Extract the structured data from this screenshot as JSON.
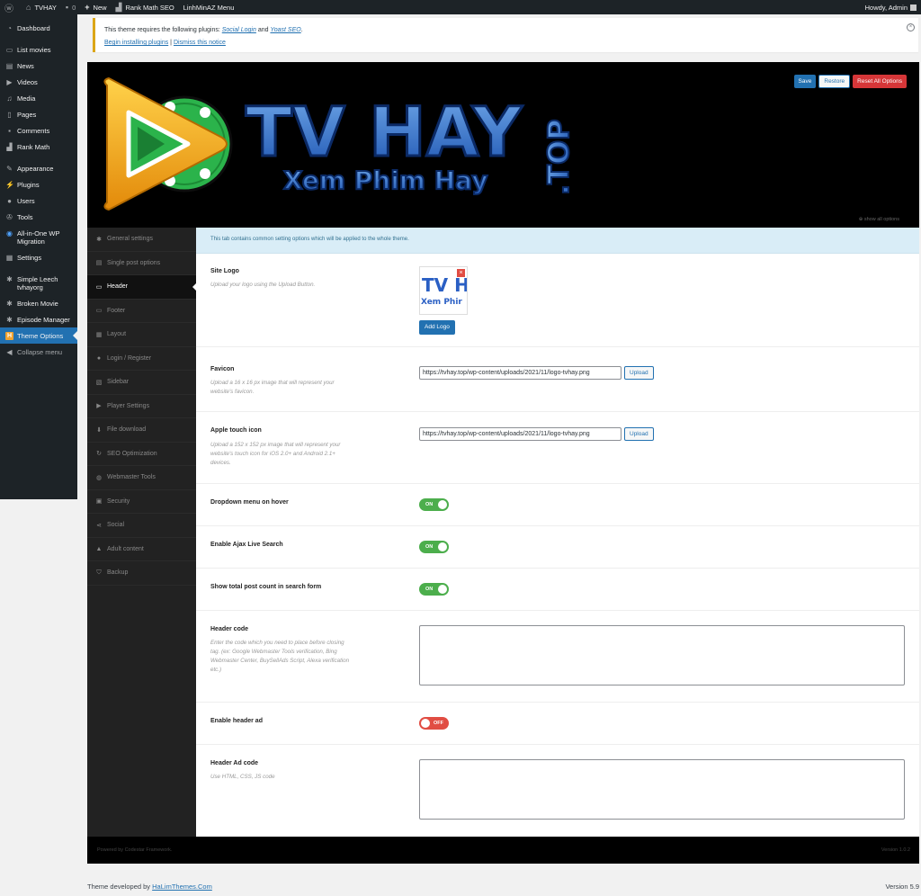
{
  "adminbar": {
    "site": "TVHAY",
    "comments": "0",
    "new": "New",
    "rankmath": "Rank Math SEO",
    "custom_menu": "LinhMinAZ Menu",
    "howdy": "Howdy, Admin"
  },
  "menu": {
    "dashboard": "Dashboard",
    "list_movies": "List movies",
    "news": "News",
    "videos": "Videos",
    "media": "Media",
    "pages": "Pages",
    "comments": "Comments",
    "rank_math": "Rank Math",
    "appearance": "Appearance",
    "plugins": "Plugins",
    "users": "Users",
    "tools": "Tools",
    "all_in_one": "All-in-One WP Migration",
    "settings": "Settings",
    "simple_leech": "Simple Leech tvhayorg",
    "broken_movie": "Broken Movie",
    "episode_manager": "Episode Manager",
    "theme_options": "Theme Options",
    "theme_options_badge": "H",
    "collapse": "Collapse menu"
  },
  "notice": {
    "prefix": "This theme requires the following plugins: ",
    "plugin1": "Social Login",
    "and": " and ",
    "plugin2": "Yoast SEO",
    "suffix": ".",
    "begin": "Begin installing plugins",
    "sep": " | ",
    "dismiss": "Dismiss this notice"
  },
  "banner": {
    "title": "TV HAY",
    "subtitle": "Xem Phim Hay",
    "tld": ".TOP",
    "save": "Save",
    "restore": "Restore",
    "reset": "Reset All Options",
    "show_all": "⊕ show all options"
  },
  "tabs": {
    "general": "General settings",
    "single_post": "Single post options",
    "header": "Header",
    "footer": "Footer",
    "layout": "Layout",
    "login": "Login / Register",
    "sidebar": "Sidebar",
    "player": "Player Settings",
    "file_download": "File download",
    "seo": "SEO Optimization",
    "webmaster": "Webmaster Tools",
    "security": "Security",
    "social": "Social",
    "adult": "Adult content",
    "backup": "Backup"
  },
  "content": {
    "info": "This tab contains common setting options which will be applied to the whole theme.",
    "site_logo": {
      "label": "Site Logo",
      "desc": "Upload your logo using the Upload Button.",
      "button": "Add Logo",
      "thumb_text1": "TV H",
      "thumb_text2": "Xem Phir"
    },
    "favicon": {
      "label": "Favicon",
      "desc": "Upload a 16 x 16 px image that will represent your website's favicon.",
      "value": "https://tvhay.top/wp-content/uploads/2021/11/logo-tvhay.png",
      "button": "Upload"
    },
    "apple_icon": {
      "label": "Apple touch icon",
      "desc": "Upload a 152 x 152 px image that will represent your website's touch icon for iOS 2.0+ and Android 2.1+ devices.",
      "value": "https://tvhay.top/wp-content/uploads/2021/11/logo-tvhay.png",
      "button": "Upload"
    },
    "dropdown_hover": {
      "label": "Dropdown menu on hover",
      "state": "ON"
    },
    "ajax_search": {
      "label": "Enable Ajax Live Search",
      "state": "ON"
    },
    "post_count": {
      "label": "Show total post count in search form",
      "state": "ON"
    },
    "header_code": {
      "label": "Header code",
      "desc": "Enter the code which you need to place before closing tag. (ex: Google Webmaster Tools verification, Bing Webmaster Center, BuySellAds Script, Alexa verification etc.)"
    },
    "header_ad": {
      "label": "Enable header ad",
      "state": "OFF"
    },
    "header_ad_code": {
      "label": "Header Ad code",
      "desc": "Use HTML, CSS, JS code"
    }
  },
  "panel_footer": {
    "left": "Powered by Codestar Framework.",
    "right": "Version 1.0.2"
  },
  "wp_footer": {
    "prefix": "Theme developed by ",
    "link": "HaLimThemes.Com",
    "version": "Version 5.9"
  },
  "colors": {
    "accent": "#2271b1",
    "notice_border": "#dba617",
    "switch_on": "#4cae4c",
    "switch_off": "#e14d43",
    "theme_badge": "#f0a330"
  }
}
